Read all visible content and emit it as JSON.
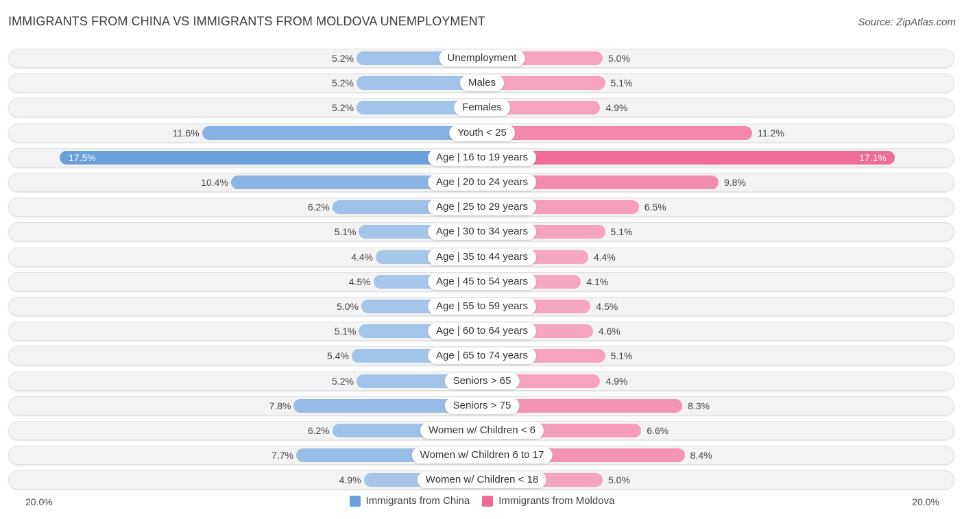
{
  "header": {
    "title": "IMMIGRANTS FROM CHINA VS IMMIGRANTS FROM MOLDOVA UNEMPLOYMENT",
    "source": "Source: ZipAtlas.com"
  },
  "colors": {
    "china_strong": "#6a9fdc",
    "china_light": "#a9c8ea",
    "moldova_strong": "#f06a96",
    "moldova_light": "#f6a8c1"
  },
  "chart_data": {
    "type": "bar",
    "orientation": "horizontal-diverging",
    "title": "IMMIGRANTS FROM CHINA VS IMMIGRANTS FROM MOLDOVA UNEMPLOYMENT",
    "xlabel": "",
    "ylabel": "",
    "xlim": [
      -20,
      20
    ],
    "axis_left_label": "20.0%",
    "axis_right_label": "20.0%",
    "legend_position": "bottom-center",
    "categories": [
      "Unemployment",
      "Males",
      "Females",
      "Youth < 25",
      "Age | 16 to 19 years",
      "Age | 20 to 24 years",
      "Age | 25 to 29 years",
      "Age | 30 to 34 years",
      "Age | 35 to 44 years",
      "Age | 45 to 54 years",
      "Age | 55 to 59 years",
      "Age | 60 to 64 years",
      "Age | 65 to 74 years",
      "Seniors > 65",
      "Seniors > 75",
      "Women w/ Children < 6",
      "Women w/ Children 6 to 17",
      "Women w/ Children < 18"
    ],
    "series": [
      {
        "name": "Immigrants from China",
        "side": "left",
        "values": [
          5.2,
          5.2,
          5.2,
          11.6,
          17.5,
          10.4,
          6.2,
          5.1,
          4.4,
          4.5,
          5.0,
          5.1,
          5.4,
          5.2,
          7.8,
          6.2,
          7.7,
          4.9
        ],
        "labels": [
          "5.2%",
          "5.2%",
          "5.2%",
          "11.6%",
          "17.5%",
          "10.4%",
          "6.2%",
          "5.1%",
          "4.4%",
          "4.5%",
          "5.0%",
          "5.1%",
          "5.4%",
          "5.2%",
          "7.8%",
          "6.2%",
          "7.7%",
          "4.9%"
        ]
      },
      {
        "name": "Immigrants from Moldova",
        "side": "right",
        "values": [
          5.0,
          5.1,
          4.9,
          11.2,
          17.1,
          9.8,
          6.5,
          5.1,
          4.4,
          4.1,
          4.5,
          4.6,
          5.1,
          4.9,
          8.3,
          6.6,
          8.4,
          5.0
        ],
        "labels": [
          "5.0%",
          "5.1%",
          "4.9%",
          "11.2%",
          "17.1%",
          "9.8%",
          "6.5%",
          "5.1%",
          "4.4%",
          "4.1%",
          "4.5%",
          "4.6%",
          "5.1%",
          "4.9%",
          "8.3%",
          "6.6%",
          "8.4%",
          "5.0%"
        ]
      }
    ]
  },
  "legend": {
    "items": [
      {
        "label": "Immigrants from China"
      },
      {
        "label": "Immigrants from Moldova"
      }
    ]
  }
}
